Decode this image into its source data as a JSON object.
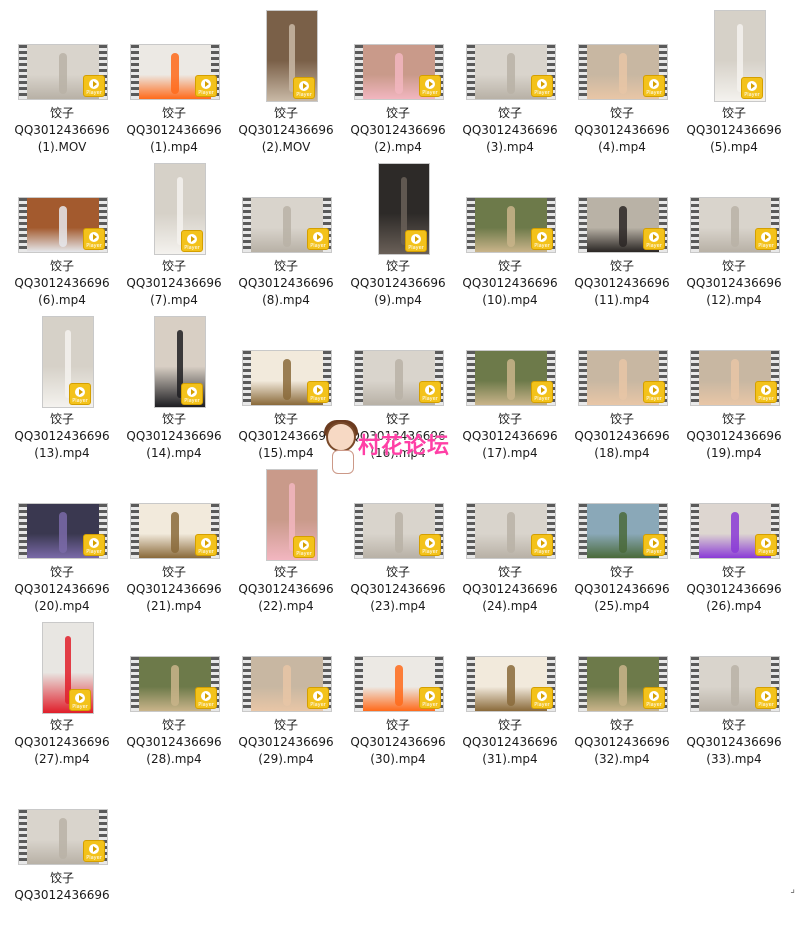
{
  "files": [
    {
      "name_line1": "饺子",
      "name_line2": "QQ3012436696",
      "name_line3": "(1).MOV",
      "orient": "land",
      "scene": "room-white"
    },
    {
      "name_line1": "饺子",
      "name_line2": "QQ3012436696",
      "name_line3": "(1).mp4",
      "orient": "land",
      "scene": "orange"
    },
    {
      "name_line1": "饺子",
      "name_line2": "QQ3012436696",
      "name_line3": "(2).MOV",
      "orient": "port",
      "scene": "door"
    },
    {
      "name_line1": "饺子",
      "name_line2": "QQ3012436696",
      "name_line3": "(2).mp4",
      "orient": "land",
      "scene": "pink-bed"
    },
    {
      "name_line1": "饺子",
      "name_line2": "QQ3012436696",
      "name_line3": "(3).mp4",
      "orient": "land",
      "scene": "room-white"
    },
    {
      "name_line1": "饺子",
      "name_line2": "QQ3012436696",
      "name_line3": "(4).mp4",
      "orient": "land",
      "scene": "skin"
    },
    {
      "name_line1": "饺子",
      "name_line2": "QQ3012436696",
      "name_line3": "(5).mp4",
      "orient": "port",
      "scene": "white-outfit"
    },
    {
      "name_line1": "饺子",
      "name_line2": "QQ3012436696",
      "name_line3": "(6).mp4",
      "orient": "land",
      "scene": "sofa"
    },
    {
      "name_line1": "饺子",
      "name_line2": "QQ3012436696",
      "name_line3": "(7).mp4",
      "orient": "port",
      "scene": "white-outfit"
    },
    {
      "name_line1": "饺子",
      "name_line2": "QQ3012436696",
      "name_line3": "(8).mp4",
      "orient": "land",
      "scene": "room-white"
    },
    {
      "name_line1": "饺子",
      "name_line2": "QQ3012436696",
      "name_line3": "(9).mp4",
      "orient": "port",
      "scene": "dark"
    },
    {
      "name_line1": "饺子",
      "name_line2": "QQ3012436696",
      "name_line3": "(10).mp4",
      "orient": "land",
      "scene": "plants"
    },
    {
      "name_line1": "饺子",
      "name_line2": "QQ3012436696",
      "name_line3": "(11).mp4",
      "orient": "land",
      "scene": "room-dark"
    },
    {
      "name_line1": "饺子",
      "name_line2": "QQ3012436696",
      "name_line3": "(12).mp4",
      "orient": "land",
      "scene": "room-white"
    },
    {
      "name_line1": "饺子",
      "name_line2": "QQ3012436696",
      "name_line3": "(13).mp4",
      "orient": "port",
      "scene": "white-outfit"
    },
    {
      "name_line1": "饺子",
      "name_line2": "QQ3012436696",
      "name_line3": "(14).mp4",
      "orient": "port",
      "scene": "suit"
    },
    {
      "name_line1": "饺子",
      "name_line2": "QQ3012436696",
      "name_line3": "(15).mp4",
      "orient": "land",
      "scene": "cartoon"
    },
    {
      "name_line1": "饺子",
      "name_line2": "QQ3012436696",
      "name_line3": "(16).mp4",
      "orient": "land",
      "scene": "room-white"
    },
    {
      "name_line1": "饺子",
      "name_line2": "QQ3012436696",
      "name_line3": "(17).mp4",
      "orient": "land",
      "scene": "plants"
    },
    {
      "name_line1": "饺子",
      "name_line2": "QQ3012436696",
      "name_line3": "(18).mp4",
      "orient": "land",
      "scene": "skin"
    },
    {
      "name_line1": "饺子",
      "name_line2": "QQ3012436696",
      "name_line3": "(19).mp4",
      "orient": "land",
      "scene": "skin"
    },
    {
      "name_line1": "饺子",
      "name_line2": "QQ3012436696",
      "name_line3": "(20).mp4",
      "orient": "land",
      "scene": "gym"
    },
    {
      "name_line1": "饺子",
      "name_line2": "QQ3012436696",
      "name_line3": "(21).mp4",
      "orient": "land",
      "scene": "cartoon"
    },
    {
      "name_line1": "饺子",
      "name_line2": "QQ3012436696",
      "name_line3": "(22).mp4",
      "orient": "port",
      "scene": "pink-bed"
    },
    {
      "name_line1": "饺子",
      "name_line2": "QQ3012436696",
      "name_line3": "(23).mp4",
      "orient": "land",
      "scene": "room-white"
    },
    {
      "name_line1": "饺子",
      "name_line2": "QQ3012436696",
      "name_line3": "(24).mp4",
      "orient": "land",
      "scene": "room-white"
    },
    {
      "name_line1": "饺子",
      "name_line2": "QQ3012436696",
      "name_line3": "(25).mp4",
      "orient": "land",
      "scene": "lake"
    },
    {
      "name_line1": "饺子",
      "name_line2": "QQ3012436696",
      "name_line3": "(26).mp4",
      "orient": "land",
      "scene": "purple"
    },
    {
      "name_line1": "饺子",
      "name_line2": "QQ3012436696",
      "name_line3": "(27).mp4",
      "orient": "port",
      "scene": "red"
    },
    {
      "name_line1": "饺子",
      "name_line2": "QQ3012436696",
      "name_line3": "(28).mp4",
      "orient": "land",
      "scene": "plants"
    },
    {
      "name_line1": "饺子",
      "name_line2": "QQ3012436696",
      "name_line3": "(29).mp4",
      "orient": "land",
      "scene": "skin"
    },
    {
      "name_line1": "饺子",
      "name_line2": "QQ3012436696",
      "name_line3": "(30).mp4",
      "orient": "land",
      "scene": "orange"
    },
    {
      "name_line1": "饺子",
      "name_line2": "QQ3012436696",
      "name_line3": "(31).mp4",
      "orient": "land",
      "scene": "cartoon"
    },
    {
      "name_line1": "饺子",
      "name_line2": "QQ3012436696",
      "name_line3": "(32).mp4",
      "orient": "land",
      "scene": "plants"
    },
    {
      "name_line1": "饺子",
      "name_line2": "QQ3012436696",
      "name_line3": "(33).mp4",
      "orient": "land",
      "scene": "room-white"
    },
    {
      "name_line1": "饺子",
      "name_line2": "QQ3012436696",
      "name_line3": "",
      "orient": "land",
      "scene": "room-white"
    }
  ],
  "player_badge_text": "Player",
  "watermark_text": "村花论坛",
  "scene_colors": {
    "room-white": [
      "#d9d4cc",
      "#b8b1a6"
    ],
    "orange": [
      "#ece9e4",
      "#ff6a1a"
    ],
    "door": [
      "#7a6048",
      "#c9b9a6"
    ],
    "pink-bed": [
      "#c99a8a",
      "#f2b6c0"
    ],
    "skin": [
      "#c8b7a2",
      "#e8c6a6"
    ],
    "white-outfit": [
      "#d6d1c8",
      "#f4f2ee"
    ],
    "sofa": [
      "#a35a2e",
      "#e6e8ec"
    ],
    "dark": [
      "#2d2a28",
      "#6a6058"
    ],
    "plants": [
      "#6d7a4a",
      "#c9b48a"
    ],
    "room-dark": [
      "#b9b2a6",
      "#2a2624"
    ],
    "suit": [
      "#d8cfc4",
      "#1e1e22"
    ],
    "cartoon": [
      "#f2eadc",
      "#8a6a3a"
    ],
    "gym": [
      "#3a3850",
      "#7a6aa8"
    ],
    "lake": [
      "#8aa8b8",
      "#4a6a3a"
    ],
    "purple": [
      "#ddd6d0",
      "#8a3ad6"
    ],
    "red": [
      "#e8e6e2",
      "#e01e2a"
    ]
  }
}
